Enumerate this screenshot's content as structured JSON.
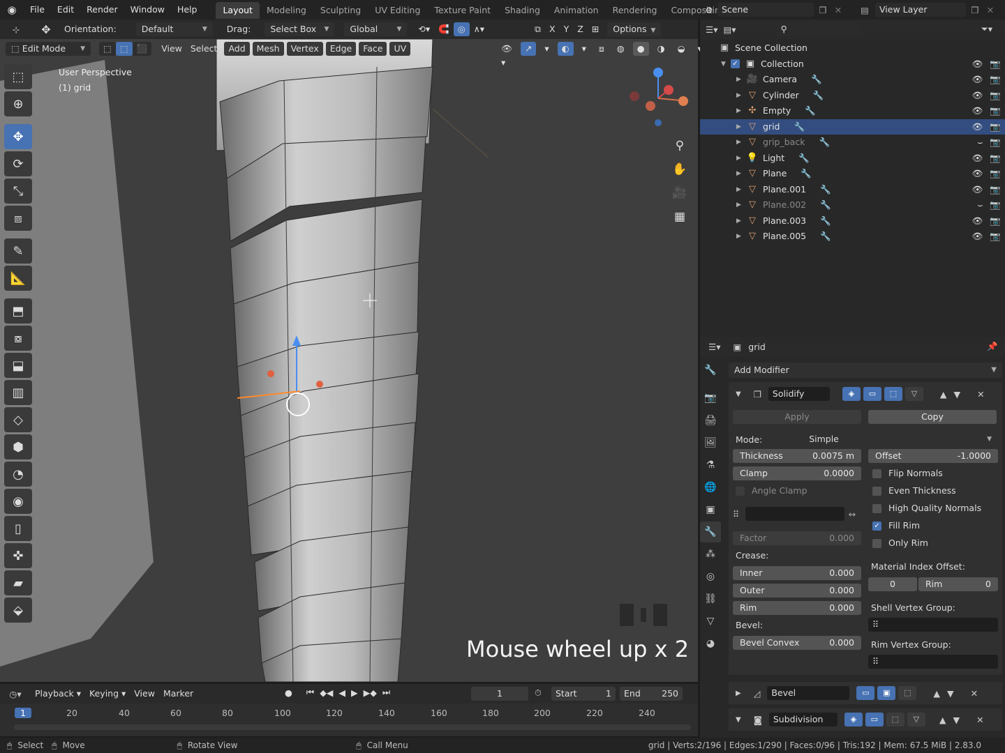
{
  "topbar": {
    "menus": [
      "File",
      "Edit",
      "Render",
      "Window",
      "Help"
    ],
    "workspaces": [
      "Layout",
      "Modeling",
      "Sculpting",
      "UV Editing",
      "Texture Paint",
      "Shading",
      "Animation",
      "Rendering",
      "Compositing"
    ],
    "active_workspace": "Layout",
    "scene_label": "Scene",
    "view_layer_label": "View Layer"
  },
  "tool_header": {
    "orientation_label": "Orientation:",
    "orientation_value": "Default",
    "drag_label": "Drag:",
    "drag_value": "Select Box",
    "transform_space": "Global",
    "axes": [
      "X",
      "Y",
      "Z"
    ],
    "options_label": "Options"
  },
  "viewport_header": {
    "mode": "Edit Mode",
    "menus": [
      "View",
      "Select",
      "Add",
      "Mesh",
      "Vertex",
      "Edge",
      "Face",
      "UV"
    ]
  },
  "viewport": {
    "perspective_label": "User Perspective",
    "object_label": "(1) grid",
    "overlay_text": "Mouse wheel up x 2"
  },
  "outliner": {
    "root": "Scene Collection",
    "collection": "Collection",
    "items": [
      {
        "name": "Camera",
        "selected": false,
        "hidden": false
      },
      {
        "name": "Cylinder",
        "selected": false,
        "hidden": false
      },
      {
        "name": "Empty",
        "selected": false,
        "hidden": false
      },
      {
        "name": "grid",
        "selected": true,
        "hidden": false
      },
      {
        "name": "grip_back",
        "selected": false,
        "hidden": true
      },
      {
        "name": "Light",
        "selected": false,
        "hidden": false
      },
      {
        "name": "Plane",
        "selected": false,
        "hidden": false
      },
      {
        "name": "Plane.001",
        "selected": false,
        "hidden": false
      },
      {
        "name": "Plane.002",
        "selected": false,
        "hidden": true
      },
      {
        "name": "Plane.003",
        "selected": false,
        "hidden": false
      },
      {
        "name": "Plane.005",
        "selected": false,
        "hidden": false
      }
    ]
  },
  "properties": {
    "object_name": "grid",
    "add_modifier_label": "Add Modifier",
    "solidify": {
      "name": "Solidify",
      "apply_label": "Apply",
      "copy_label": "Copy",
      "mode_label": "Mode:",
      "mode_value": "Simple",
      "thickness_label": "Thickness",
      "thickness_value": "0.0075 m",
      "offset_label": "Offset",
      "offset_value": "-1.0000",
      "clamp_label": "Clamp",
      "clamp_value": "0.0000",
      "angle_clamp_label": "Angle Clamp",
      "factor_label": "Factor",
      "factor_value": "0.000",
      "crease_label": "Crease:",
      "inner_label": "Inner",
      "inner_value": "0.000",
      "outer_label": "Outer",
      "outer_value": "0.000",
      "rim_label": "Rim",
      "rim_value": "0.000",
      "bevel_label": "Bevel:",
      "bevel_convex_label": "Bevel Convex",
      "bevel_convex_value": "0.000",
      "flip_normals_label": "Flip Normals",
      "even_thickness_label": "Even Thickness",
      "high_quality_normals_label": "High Quality Normals",
      "fill_rim_label": "Fill Rim",
      "only_rim_label": "Only Rim",
      "checks": {
        "flip_normals": false,
        "even_thickness": false,
        "high_quality_normals": false,
        "fill_rim": true,
        "only_rim": false
      },
      "material_index_offset_label": "Material Index Offset:",
      "material_index_offset_value": "0",
      "rim_index_label": "Rim",
      "rim_index_value": "0",
      "shell_vertex_group_label": "Shell Vertex Group:",
      "rim_vertex_group_label": "Rim Vertex Group:"
    },
    "bevel_modifier_name": "Bevel",
    "subdivision_modifier_name": "Subdivision"
  },
  "timeline": {
    "menus": [
      "Playback",
      "Keying",
      "View",
      "Marker"
    ],
    "current_frame": "1",
    "start_label": "Start",
    "start_value": "1",
    "end_label": "End",
    "end_value": "250",
    "ticks": [
      "1",
      "20",
      "40",
      "60",
      "80",
      "100",
      "120",
      "140",
      "160",
      "180",
      "200",
      "220",
      "240"
    ]
  },
  "statusbar": {
    "select_label": "Select",
    "move_label": "Move",
    "rotate_label": "Rotate View",
    "call_menu_label": "Call Menu",
    "stats": "grid | Verts:2/196 | Edges:1/290 | Faces:0/96 | Tris:192 | Mem: 67.5 MiB | 2.83.0"
  },
  "colors": {
    "accent": "#4772b3",
    "selection_row": "#334d80",
    "viewport_bg": "#3e3e3e"
  }
}
